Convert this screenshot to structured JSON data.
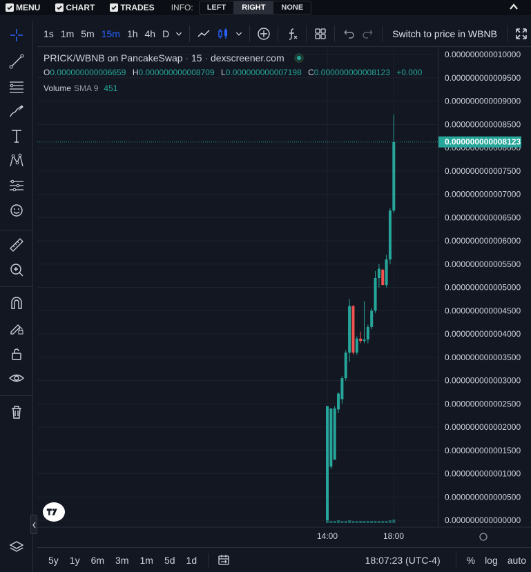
{
  "topbar": {
    "menu_label": "MENU",
    "chart_label": "CHART",
    "trades_label": "TRADES",
    "info_label": "INFO:",
    "info_options": [
      "LEFT",
      "RIGHT",
      "NONE"
    ],
    "info_selected": "RIGHT"
  },
  "toolbar": {
    "timeframes": [
      "1s",
      "1m",
      "5m",
      "15m",
      "1h",
      "4h",
      "D"
    ],
    "active_timeframe": "15m",
    "switch_label": "Switch to price in WBNB"
  },
  "legend": {
    "pair": "PRICK/WBNB on PancakeSwap",
    "interval": "15",
    "source": "dexscreener.com",
    "o_label": "O",
    "o_value": "0.000000000006659",
    "h_label": "H",
    "h_value": "0.000000000008709",
    "l_label": "L",
    "l_value": "0.000000000007198",
    "c_label": "C",
    "c_value": "0.000000000008123",
    "change": "+0.000",
    "volume_label": "Volume",
    "volume_sma": "SMA 9",
    "volume_value": "451"
  },
  "bottombar": {
    "ranges": [
      "5y",
      "1y",
      "6m",
      "3m",
      "1m",
      "5d",
      "1d"
    ],
    "time": "18:07:23 (UTC-4)",
    "percent_label": "%",
    "log_label": "log",
    "auto_label": "auto"
  },
  "colors": {
    "up": "#26a69a",
    "down": "#ef5350",
    "background": "#131722",
    "grid": "#1e222d",
    "accent": "#2962ff"
  },
  "chart_data": {
    "type": "candlestick",
    "y_ticks": [
      "0.000000000000000",
      "0.000000000000500",
      "0.000000000001000",
      "0.000000000001500",
      "0.000000000002000",
      "0.000000000002500",
      "0.000000000003000",
      "0.000000000003500",
      "0.000000000004000",
      "0.000000000004500",
      "0.000000000005000",
      "0.000000000005500",
      "0.000000000006000",
      "0.000000000006500",
      "0.000000000007000",
      "0.000000000007500",
      "0.000000000008000",
      "0.000000000008500",
      "0.000000000009000",
      "0.000000000009500",
      "0.000000000010000"
    ],
    "ylim": [
      0,
      10
    ],
    "y_unit_scale": "1e-12",
    "current_price_label": "0.000000000008123",
    "current_price": 8.123,
    "x_ticks": [
      "14:00",
      "18:00"
    ],
    "candles": [
      {
        "o": 0.0,
        "h": 2.45,
        "l": 0.0,
        "c": 2.45
      },
      {
        "o": 1.15,
        "h": 2.4,
        "l": 1.1,
        "c": 2.4
      },
      {
        "o": 1.3,
        "h": 2.45,
        "l": 1.3,
        "c": 2.4
      },
      {
        "o": 2.38,
        "h": 2.75,
        "l": 2.3,
        "c": 2.72
      },
      {
        "o": 2.6,
        "h": 3.1,
        "l": 2.5,
        "c": 3.05
      },
      {
        "o": 3.05,
        "h": 3.65,
        "l": 3.0,
        "c": 3.6
      },
      {
        "o": 3.6,
        "h": 4.75,
        "l": 3.4,
        "c": 4.6
      },
      {
        "o": 4.6,
        "h": 4.62,
        "l": 3.55,
        "c": 3.6
      },
      {
        "o": 3.6,
        "h": 3.95,
        "l": 3.55,
        "c": 3.9
      },
      {
        "o": 3.9,
        "h": 4.05,
        "l": 3.8,
        "c": 3.85
      },
      {
        "o": 3.85,
        "h": 4.7,
        "l": 3.8,
        "c": 3.88
      },
      {
        "o": 3.88,
        "h": 4.2,
        "l": 3.8,
        "c": 4.15
      },
      {
        "o": 4.15,
        "h": 4.55,
        "l": 4.1,
        "c": 4.5
      },
      {
        "o": 4.5,
        "h": 5.35,
        "l": 4.45,
        "c": 5.2
      },
      {
        "o": 5.2,
        "h": 5.5,
        "l": 5.0,
        "c": 5.4
      },
      {
        "o": 5.38,
        "h": 5.4,
        "l": 5.05,
        "c": 5.05
      },
      {
        "o": 5.05,
        "h": 5.7,
        "l": 5.0,
        "c": 5.6
      },
      {
        "o": 5.6,
        "h": 6.7,
        "l": 5.5,
        "c": 6.65
      },
      {
        "o": 6.65,
        "h": 8.71,
        "l": 6.6,
        "c": 8.12
      }
    ],
    "volumes": [
      6,
      3,
      3,
      4,
      3,
      3,
      4,
      3,
      3,
      3,
      3,
      3,
      3,
      3,
      3,
      3,
      3,
      4,
      5
    ]
  }
}
